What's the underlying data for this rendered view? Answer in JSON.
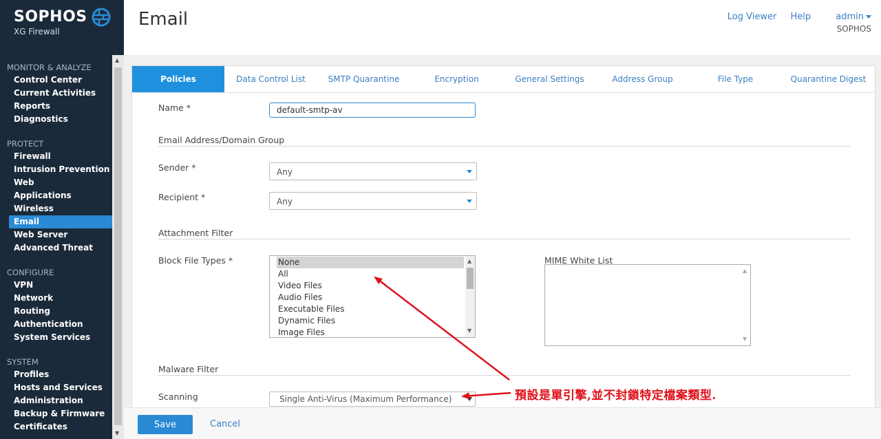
{
  "brand": {
    "name": "SOPHOS",
    "product": "XG Firewall"
  },
  "colors": {
    "sidebar_bg": "#1b2a3a",
    "accent": "#2a8ad4",
    "annotation": "#e0101a"
  },
  "nav": {
    "sections": [
      {
        "title": "MONITOR & ANALYZE",
        "items": [
          "Control Center",
          "Current Activities",
          "Reports",
          "Diagnostics"
        ]
      },
      {
        "title": "PROTECT",
        "items": [
          "Firewall",
          "Intrusion Prevention",
          "Web",
          "Applications",
          "Wireless",
          "Email",
          "Web Server",
          "Advanced Threat"
        ]
      },
      {
        "title": "CONFIGURE",
        "items": [
          "VPN",
          "Network",
          "Routing",
          "Authentication",
          "System Services"
        ]
      },
      {
        "title": "SYSTEM",
        "items": [
          "Profiles",
          "Hosts and Services",
          "Administration",
          "Backup & Firmware",
          "Certificates"
        ]
      }
    ],
    "active": "Email"
  },
  "header": {
    "title": "Email",
    "log_viewer": "Log Viewer",
    "help": "Help",
    "user": "admin",
    "org": "SOPHOS"
  },
  "tabs": [
    {
      "label": "Policies",
      "active": true
    },
    {
      "label": "Data Control List",
      "active": false
    },
    {
      "label": "SMTP Quarantine",
      "active": false
    },
    {
      "label": "Encryption",
      "active": false
    },
    {
      "label": "General Settings",
      "active": false
    },
    {
      "label": "Address Group",
      "active": false
    },
    {
      "label": "File Type",
      "active": false
    },
    {
      "label": "Quarantine Digest",
      "active": false
    }
  ],
  "form": {
    "name_label": "Name *",
    "name_value": "default-smtp-av",
    "email_group_title": "Email Address/Domain Group",
    "sender_label": "Sender *",
    "sender_value": "Any",
    "recipient_label": "Recipient *",
    "recipient_value": "Any",
    "attachment_title": "Attachment Filter",
    "block_types_label": "Block File Types *",
    "block_types_options": [
      "None",
      "All",
      "Video Files",
      "Audio Files",
      "Executable Files",
      "Dynamic Files",
      "Image Files"
    ],
    "block_types_selected": "None",
    "mime_label": "MIME White List",
    "malware_title": "Malware Filter",
    "scanning_label": "Scanning",
    "scanning_value": "Single Anti-Virus (Maximum Performance)"
  },
  "footer": {
    "save": "Save",
    "cancel": "Cancel"
  },
  "annotation": {
    "text": "預設是單引擎,並不封鎖特定檔案類型."
  }
}
